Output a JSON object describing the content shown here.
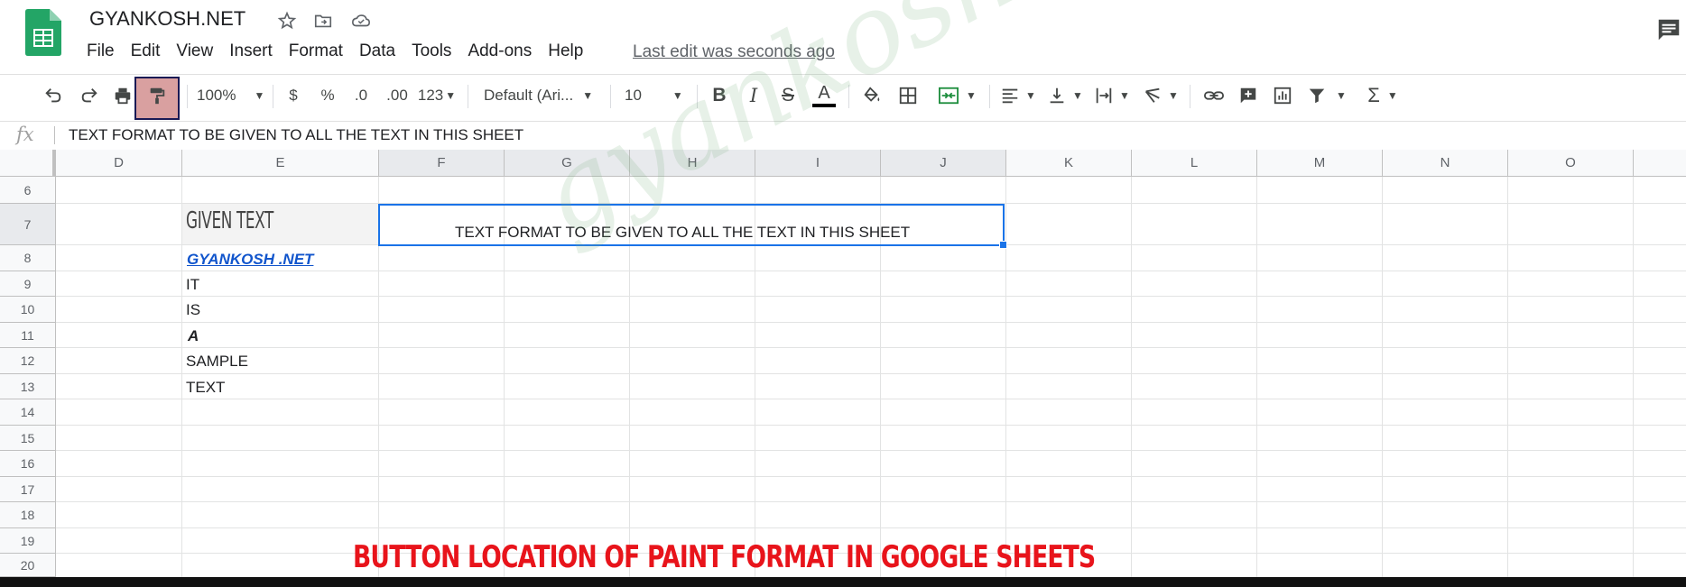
{
  "app": {
    "title": "GYANKOSH.NET",
    "last_edit": "Last edit was seconds ago"
  },
  "menu": [
    "File",
    "Edit",
    "View",
    "Insert",
    "Format",
    "Data",
    "Tools",
    "Add-ons",
    "Help"
  ],
  "toolbar": {
    "zoom": "100%",
    "currency": "$",
    "percent": "%",
    "decrease_decimal": ".0",
    "increase_decimal": ".00",
    "more_formats": "123",
    "font": "Default (Ari...",
    "font_size": "10",
    "bold": "B",
    "italic": "I",
    "strike": "S",
    "text_color": "A",
    "sum": "Σ"
  },
  "formula_bar": {
    "fx": "fx",
    "value": "TEXT FORMAT TO BE GIVEN TO ALL THE TEXT IN THIS SHEET"
  },
  "columns": [
    "D",
    "E",
    "F",
    "G",
    "H",
    "I",
    "J",
    "K",
    "L",
    "M",
    "N",
    "O"
  ],
  "rows": [
    "6",
    "7",
    "8",
    "9",
    "10",
    "11",
    "12",
    "13",
    "14",
    "15",
    "16",
    "17",
    "18",
    "19",
    "20"
  ],
  "cells": {
    "e7": "GIVEN TEXT",
    "f7": "TEXT FORMAT TO BE GIVEN TO ALL THE TEXT IN THIS SHEET",
    "e8": "GYANKOSH .NET",
    "e9": "IT",
    "e10": "IS",
    "e11": "A",
    "e12": "SAMPLE",
    "e13": "TEXT"
  },
  "watermark": "gyankosh.net",
  "caption": "BUTTON LOCATION OF PAINT FORMAT IN GOOGLE SHEETS",
  "colors": {
    "accent": "#1a73e8",
    "caption": "#e8141b",
    "sheets_green": "#23a566",
    "paint_highlight": "#d9a0a0"
  }
}
